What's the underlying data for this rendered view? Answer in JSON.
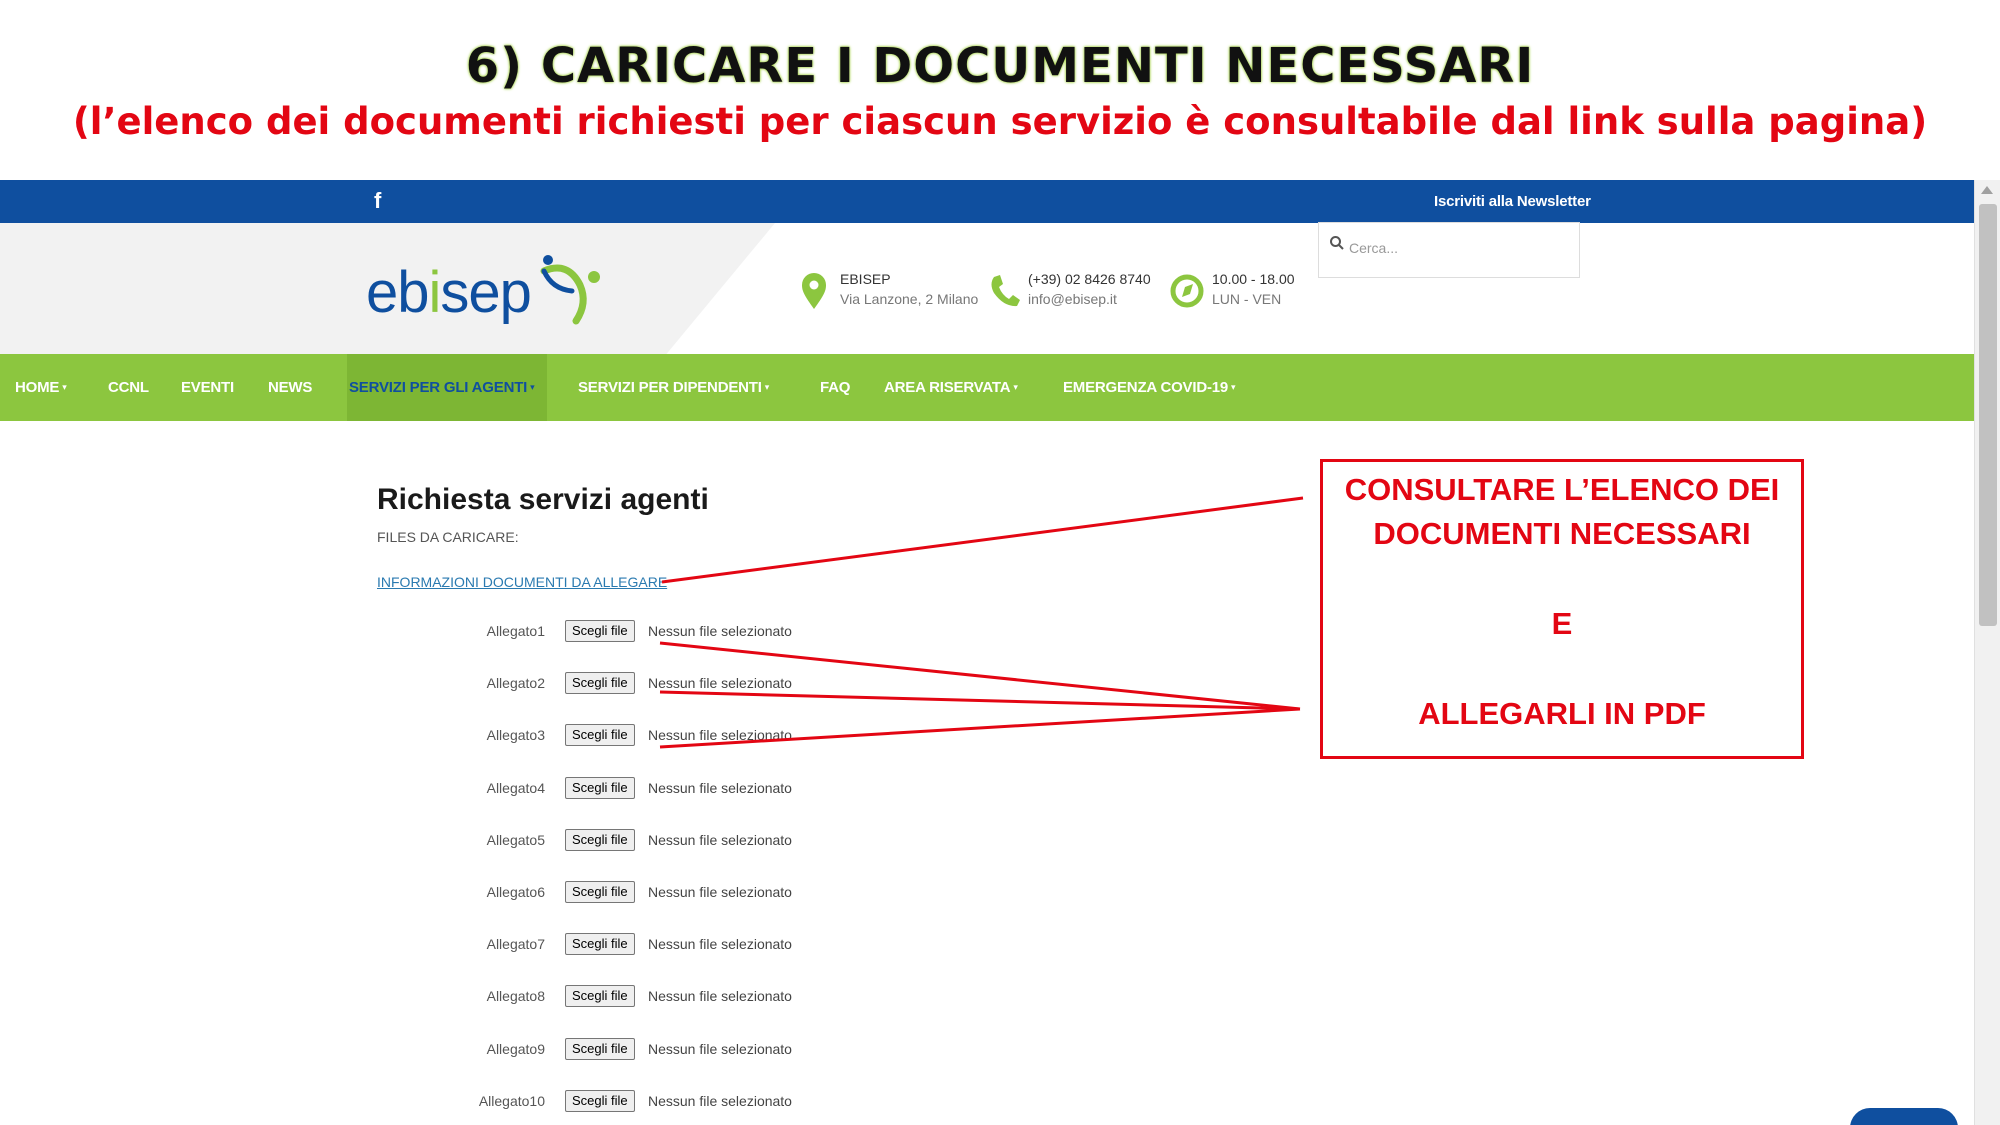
{
  "slide": {
    "title": "6) CARICARE I DOCUMENTI NECESSARI",
    "subtitle": "(l’elenco dei documenti richiesti per ciascun servizio è consultabile dal link sulla pagina)"
  },
  "topbar": {
    "facebook_icon": "f",
    "newsletter_label": "Iscriviti alla Newsletter"
  },
  "header": {
    "logo_text_pre": "eb",
    "logo_text_i": "i",
    "logo_text_post": "sep",
    "address_title": "EBISEP",
    "address_detail": "Via Lanzone, 2 Milano",
    "phone": "(+39) 02 8426 8740",
    "email": "info@ebisep.it",
    "hours": "10.00 - 18.00",
    "days": "LUN - VEN",
    "search_placeholder": "Cerca..."
  },
  "nav": {
    "items": [
      {
        "label": "HOME",
        "caret": "▾"
      },
      {
        "label": "CCNL"
      },
      {
        "label": "EVENTI"
      },
      {
        "label": "NEWS"
      },
      {
        "label": "SERVIZI PER GLI AGENTI",
        "caret": "▾"
      },
      {
        "label": "SERVIZI PER DIPENDENTI",
        "caret": "▾"
      },
      {
        "label": "FAQ"
      },
      {
        "label": "AREA RISERVATA",
        "caret": "▾"
      },
      {
        "label": "EMERGENZA COVID-19",
        "caret": "▾"
      }
    ]
  },
  "content": {
    "title": "Richiesta servizi agenti",
    "files_label": "FILES DA CARICARE:",
    "docs_link": "INFORMAZIONI DOCUMENTI DA ALLEGARE",
    "button_label": "Scegli file",
    "status": "Nessun file selezionato",
    "attachments": [
      "Allegato1",
      "Allegato2",
      "Allegato3",
      "Allegato4",
      "Allegato5",
      "Allegato6",
      "Allegato7",
      "Allegato8",
      "Allegato9",
      "Allegato10"
    ]
  },
  "callout": {
    "line1": "CONSULTARE L’ELENCO DEI",
    "line2": "DOCUMENTI NECESSARI",
    "line3": "E",
    "line4": "ALLEGARLI IN PDF"
  },
  "colors": {
    "topbar": "#0f4f9f",
    "navbar": "#8cc63f",
    "annotation_red": "#e30613"
  }
}
